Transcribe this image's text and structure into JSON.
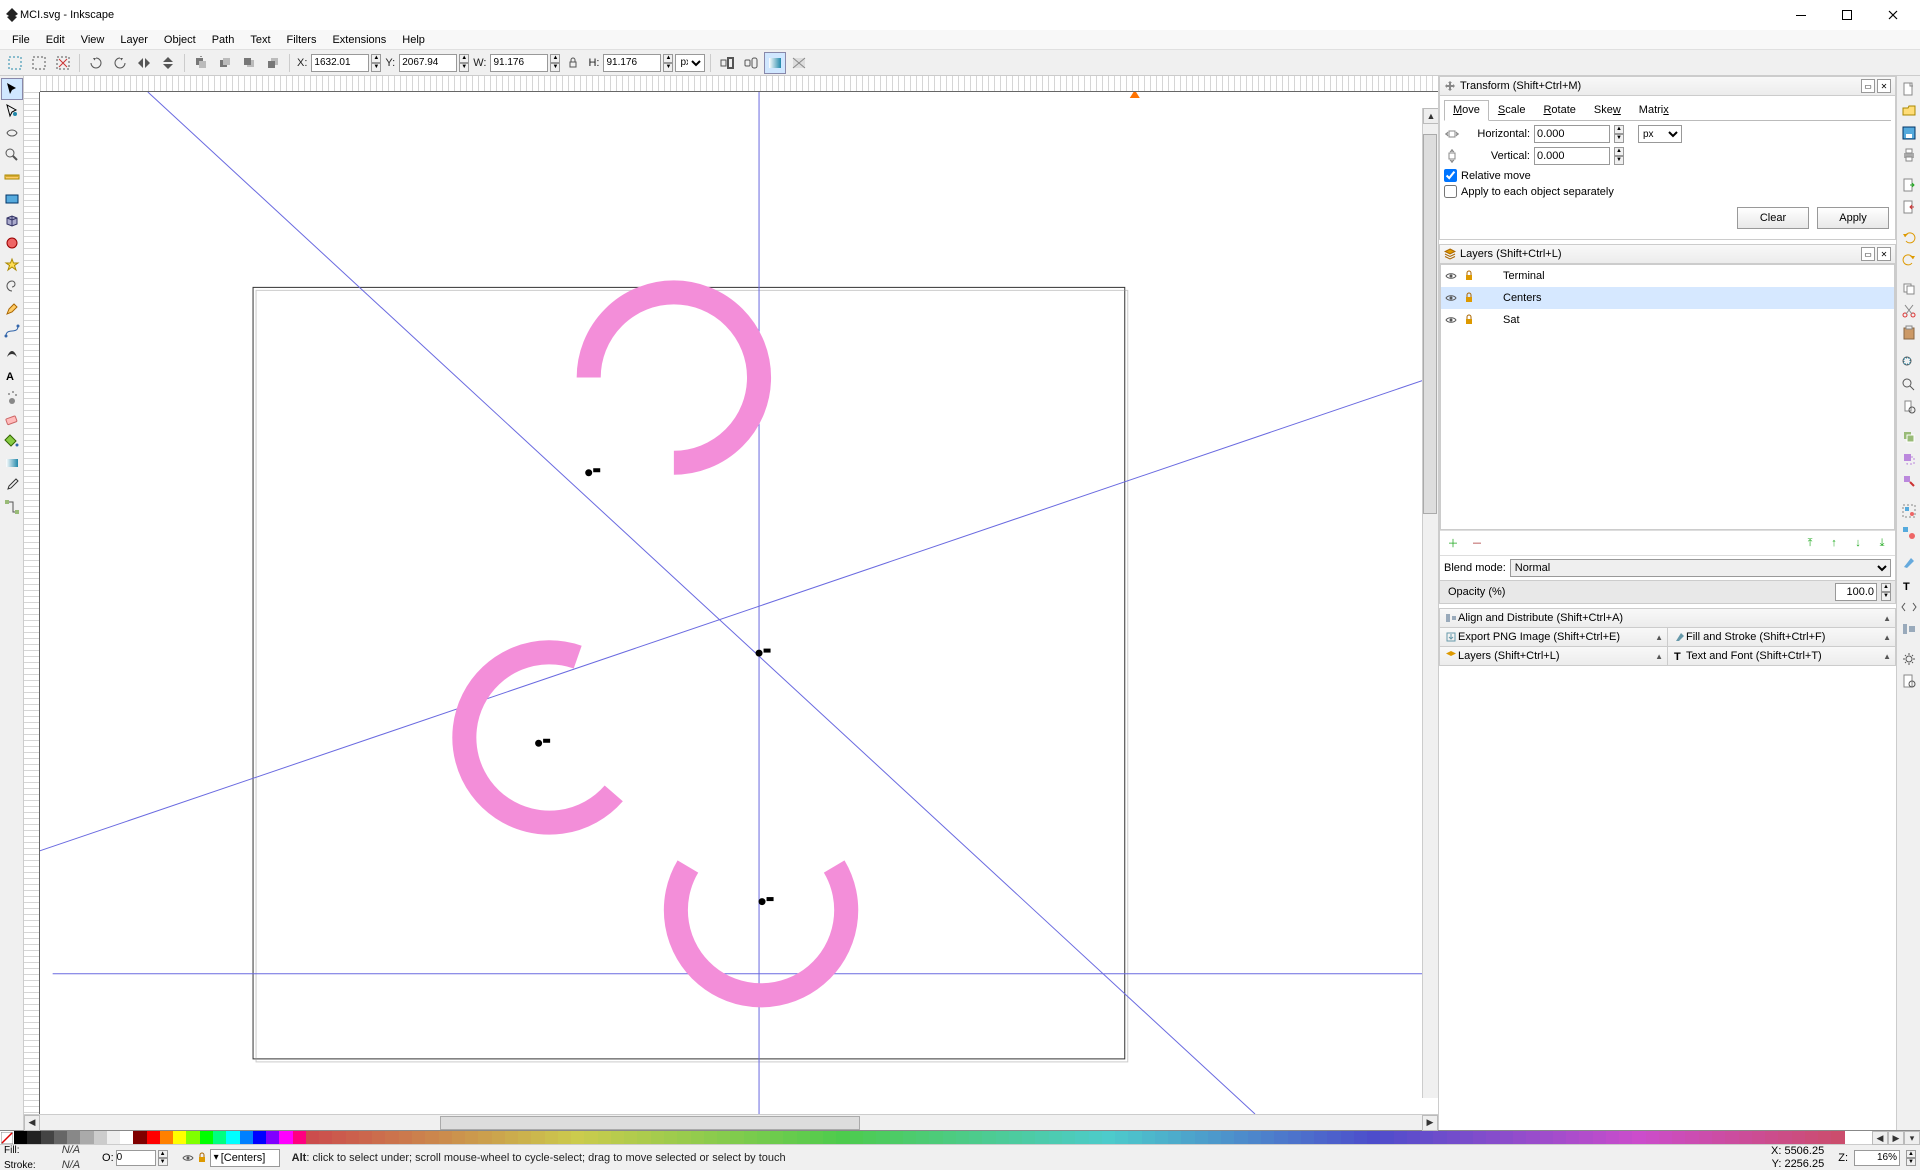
{
  "title": "MCI.svg - Inkscape",
  "menus": [
    "File",
    "Edit",
    "View",
    "Layer",
    "Object",
    "Path",
    "Text",
    "Filters",
    "Extensions",
    "Help"
  ],
  "toolbar": {
    "x": "1632.01",
    "y": "2067.94",
    "w": "91.176",
    "h": "91.176",
    "unit": "px"
  },
  "transform": {
    "title": "Transform (Shift+Ctrl+M)",
    "tabs": {
      "move": "Move",
      "scale": "Scale",
      "rotate": "Rotate",
      "skew": "Skew",
      "matrix": "Matrix"
    },
    "h_label": "Horizontal:",
    "h_value": "0.000",
    "v_label": "Vertical:",
    "v_value": "0.000",
    "unit": "px",
    "relative": "Relative move",
    "apply_each": "Apply to each object separately",
    "clear": "Clear",
    "apply": "Apply"
  },
  "layers": {
    "title": "Layers (Shift+Ctrl+L)",
    "items": [
      {
        "name": "Terminal",
        "locked": true,
        "visible": true
      },
      {
        "name": "Centers",
        "locked": true,
        "visible": true,
        "selected": true
      },
      {
        "name": "Sat",
        "locked": true,
        "visible": true
      }
    ],
    "blend_label": "Blend mode:",
    "blend_value": "Normal",
    "opacity_label": "Opacity (%)",
    "opacity_value": "100.0"
  },
  "collapsed": {
    "align": "Align and Distribute (Shift+Ctrl+A)",
    "export": "Export PNG Image (Shift+Ctrl+E)",
    "fillstroke": "Fill and Stroke (Shift+Ctrl+F)",
    "layers": "Layers (Shift+Ctrl+L)",
    "text": "Text and Font (Shift+Ctrl+T)"
  },
  "statusbar": {
    "fill": "Fill:",
    "stroke": "Stroke:",
    "fill_val": "N/A",
    "stroke_val": "N/A",
    "o_label": "O:",
    "o_value": "0",
    "layer": "[Centers]",
    "message": "Alt: click to select under; scroll mouse-wheel to cycle-select; drag to move selected or select by touch",
    "msg_prefix": "Alt",
    "coord_x": "X: 5506.25",
    "coord_y": "Y: 2256.25",
    "z_label": "Z:",
    "zoom": "16%"
  }
}
